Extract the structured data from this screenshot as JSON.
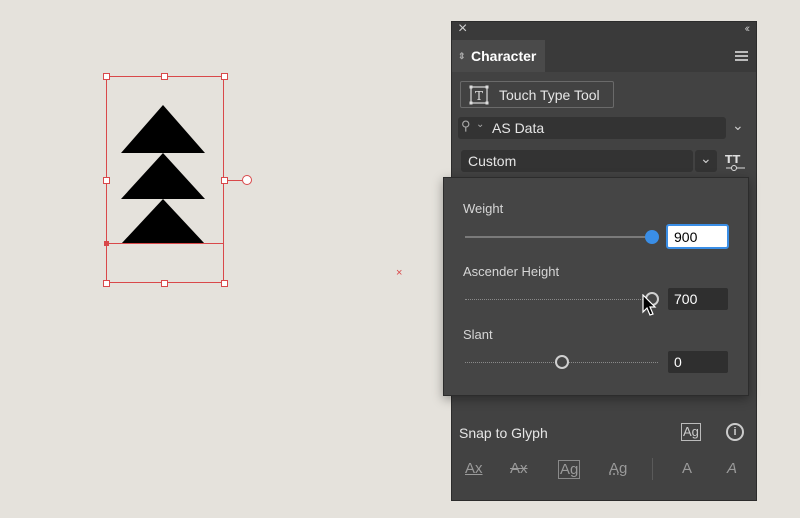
{
  "panel": {
    "close_glyph": "×",
    "collapse_glyph": "‹‹",
    "tab_title": "Character",
    "menu_icon": "hamburger-menu-icon",
    "touch_type_label": "Touch Type Tool",
    "font_family": "AS Data",
    "font_style": "Custom"
  },
  "variable_font_popover": {
    "sliders": [
      {
        "label": "Weight",
        "value": "900",
        "level": 1.0,
        "active": true
      },
      {
        "label": "Ascender Height",
        "value": "700",
        "level": 1.0,
        "active": false
      },
      {
        "label": "Slant",
        "value": "0",
        "level": 0.5,
        "active": false
      }
    ]
  },
  "snap": {
    "label": "Snap to Glyph",
    "glyph_icon_text": "Ag"
  },
  "bottom_icons": [
    "Ax",
    "Ax",
    "Ag",
    "Ag",
    "A",
    "A"
  ],
  "colors": {
    "accent": "#3a8ee6",
    "selection": "#d9484a",
    "panel_bg": "#424242"
  }
}
